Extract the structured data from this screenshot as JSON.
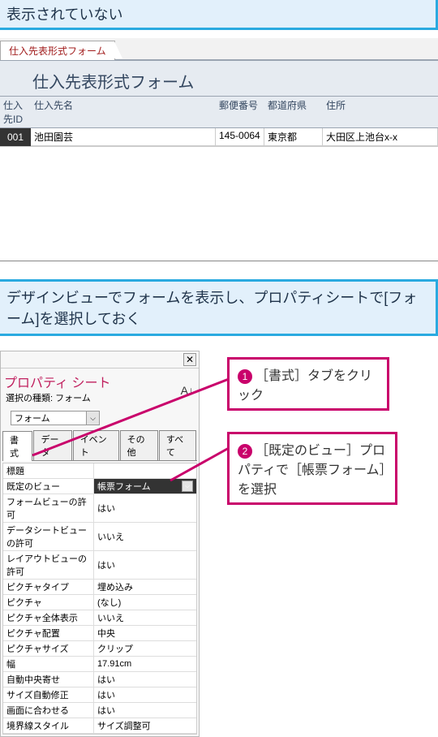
{
  "topnote": "表示されていない",
  "formtab": "仕入先表形式フォーム",
  "formtitle": "仕入先表形式フォーム",
  "cols": {
    "id": "仕入先ID",
    "name": "仕入先名",
    "zip": "郵便番号",
    "pref": "都道府県",
    "addr": "住所"
  },
  "row": {
    "id": "001",
    "name": "池田園芸",
    "zip": "145-0064",
    "pref": "東京都",
    "addr": "大田区上池台x-x"
  },
  "stepnote": "デザインビューでフォームを表示し、プロパティシートで[フォーム]を選択しておく",
  "prop": {
    "title": "プロパティ シート",
    "subtitle_prefix": "選択の種類: ",
    "subtitle_value": "フォーム",
    "selector_value": "フォーム",
    "tabs": {
      "format": "書式",
      "data": "データ",
      "event": "イベント",
      "other": "その他",
      "all": "すべて"
    }
  },
  "props": [
    {
      "name": "標題",
      "value": ""
    },
    {
      "name": "既定のビュー",
      "value": "帳票フォーム",
      "highlight": true,
      "dropdown": true
    },
    {
      "name": "フォームビューの許可",
      "value": "はい"
    },
    {
      "name": "データシートビューの許可",
      "value": "いいえ"
    },
    {
      "name": "レイアウトビューの許可",
      "value": "はい"
    },
    {
      "name": "ピクチャタイプ",
      "value": "埋め込み"
    },
    {
      "name": "ピクチャ",
      "value": "(なし)"
    },
    {
      "name": "ピクチャ全体表示",
      "value": "いいえ"
    },
    {
      "name": "ピクチャ配置",
      "value": "中央"
    },
    {
      "name": "ピクチャサイズ",
      "value": "クリップ"
    },
    {
      "name": "幅",
      "value": "17.91cm"
    },
    {
      "name": "自動中央寄せ",
      "value": "はい"
    },
    {
      "name": "サイズ自動修正",
      "value": "はい"
    },
    {
      "name": "画面に合わせる",
      "value": "はい"
    },
    {
      "name": "境界線スタイル",
      "value": "サイズ調整可"
    }
  ],
  "callout1": {
    "num": "1",
    "text": "［書式］タブをクリック"
  },
  "callout2": {
    "num": "2",
    "text": "［既定のビュー］プロパティで［帳票フォーム］を選択"
  },
  "icons": {
    "close": "✕",
    "dropdown": "⌵",
    "sort": "A↓"
  }
}
